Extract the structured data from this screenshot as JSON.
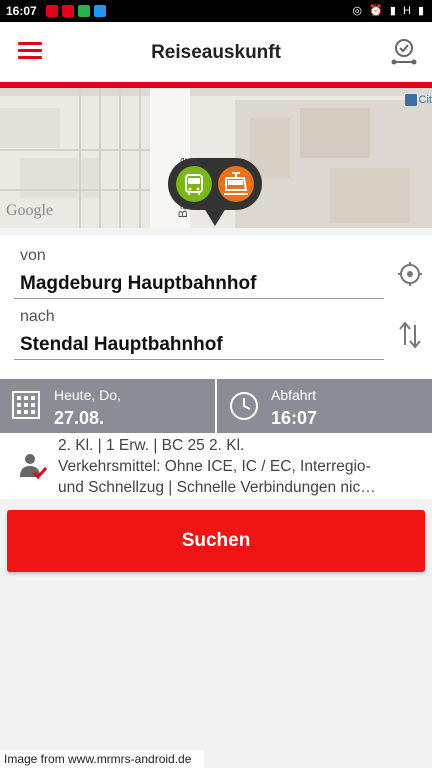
{
  "status_bar": {
    "time": "16:07",
    "network": "H"
  },
  "app_bar": {
    "title": "Reiseauskunft",
    "menu_icon": "hamburger-menu-icon",
    "right_icon": "clock-connection-icon"
  },
  "map": {
    "street_label": "Ba…straße",
    "city_label": "Cit",
    "provider": "Google",
    "marker_icons": [
      "bus-icon",
      "tram-icon"
    ]
  },
  "form": {
    "from_label": "von",
    "from_value": "Magdeburg Hauptbahnhof",
    "to_label": "nach",
    "to_value": "Stendal Hauptbahnhof"
  },
  "datetime": {
    "date_label": "Heute, Do,",
    "date_value": "27.08.",
    "time_label": "Abfahrt",
    "time_value": "16:07"
  },
  "options": {
    "line1": "2. Kl. | 1 Erw. | BC 25 2. Kl.",
    "line2": "Verkehrsmittel: Ohne ICE, IC / EC, Interregio-",
    "line3": "und Schnellzug | Schnelle Verbindungen nic…"
  },
  "search_button": {
    "label": "Suchen"
  },
  "watermark": "Image from www.mrmrs-android.de",
  "colors": {
    "accent": "#e2001a",
    "button": "#f01414",
    "datetime_bar": "#8a8d93",
    "bus": "#7cb518",
    "tram": "#e8731b"
  }
}
